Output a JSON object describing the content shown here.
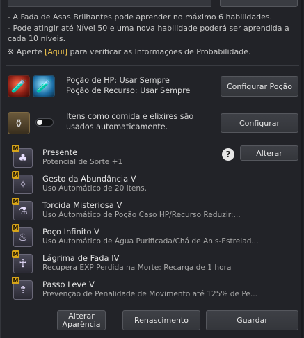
{
  "info": {
    "line1": "- A Fada de Asas Brilhantes pode aprender no máximo 6 habilidades.",
    "line2": "- Pode atingir até Nível 50 e uma nova habilidade poderá ser aprendida a cada 10 níveis.",
    "prob_symbol": "※",
    "prob_prefix": "Aperte",
    "prob_link": "[Aqui]",
    "prob_suffix": "para verificar as Informações de Probabilidade."
  },
  "potion": {
    "hp_label": "Poção de HP: Usar Sempre",
    "resource_label": "Poção de Recurso: Usar Sempre",
    "configure_button": "Configurar Poção"
  },
  "food": {
    "description": "Itens como comida e elixires são usados automaticamente.",
    "configure_button": "Configurar",
    "toggle_on": false
  },
  "skills": [
    {
      "badge": "M",
      "name": "Presente",
      "desc": "Potencial de Sorte +1",
      "icon": "clover-icon"
    },
    {
      "badge": "M",
      "name": "Gesto da Abundância V",
      "desc": "Uso Automático de 20 itens.",
      "icon": "fairy-icon"
    },
    {
      "badge": "M",
      "name": "Torcida Misteriosa V",
      "desc": "Uso Automático de Poção Caso HP/Recurso Reduzir:...",
      "icon": "potion-icon"
    },
    {
      "badge": "M",
      "name": "Poço Infinito V",
      "desc": "Uso Automático de Água Purificada/Chá de Anis-Estrelad...",
      "icon": "bowl-icon"
    },
    {
      "badge": "M",
      "name": "Lágrima de Fada IV",
      "desc": "Recupera EXP Perdida na Morte: Recarga de 1 hora",
      "icon": "tear-icon"
    },
    {
      "badge": "M",
      "name": "Passo Leve V",
      "desc": "Prevenção de Penalidade de Movimento até 125% de Pe...",
      "icon": "boot-icon"
    }
  ],
  "help_symbol": "?",
  "change_button": "Alterar",
  "footer": {
    "appearance_line1": "Alterar",
    "appearance_line2": "Aparência",
    "rebirth": "Renascimento",
    "save": "Guardar"
  }
}
